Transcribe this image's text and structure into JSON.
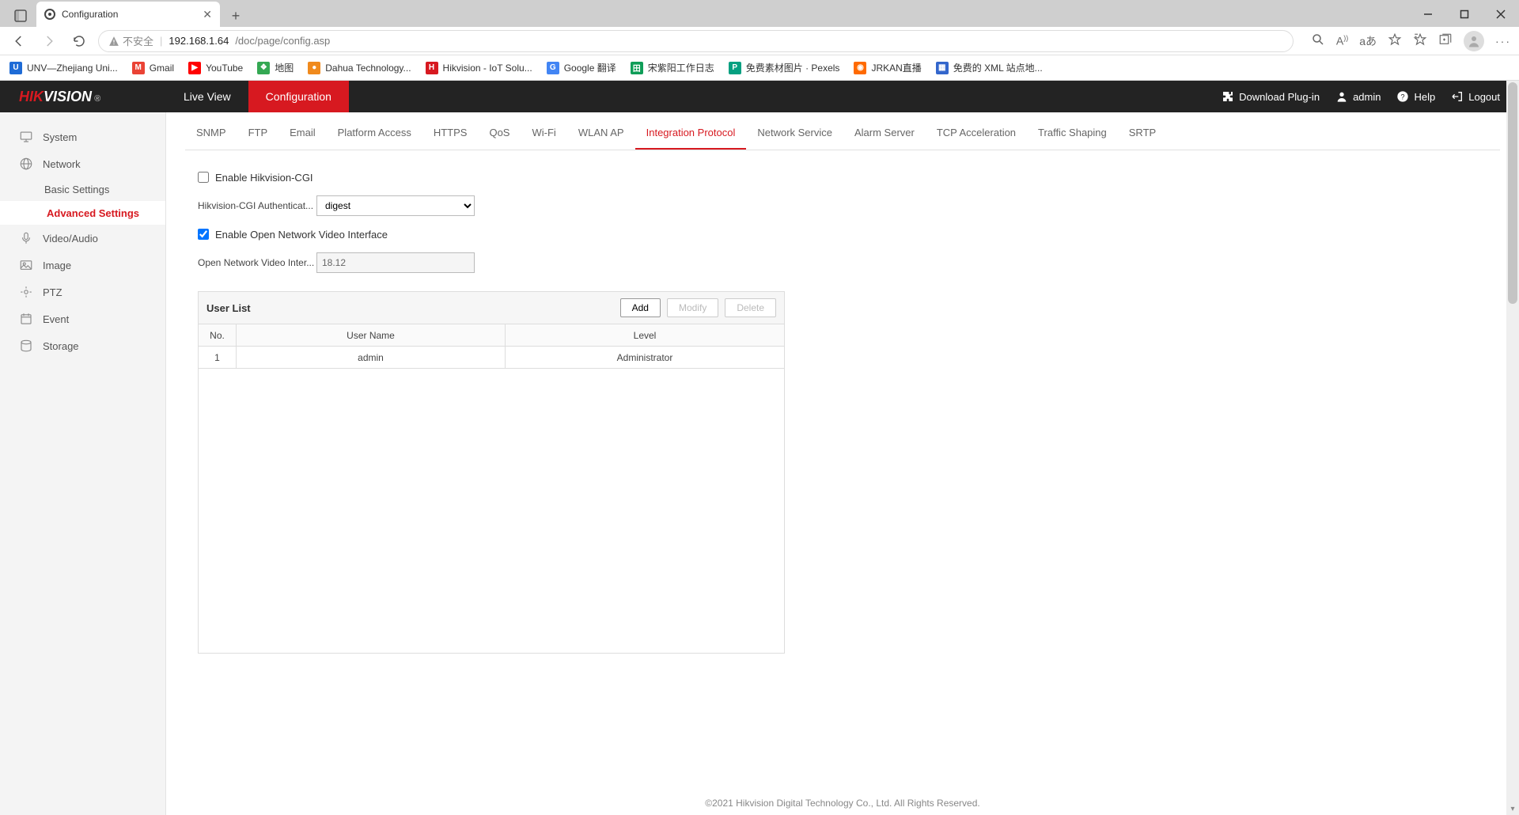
{
  "browser": {
    "tab_title": "Configuration",
    "url_warn": "不安全",
    "url_host": "192.168.1.64",
    "url_path": "/doc/page/config.asp",
    "bookmarks": [
      {
        "label": "UNV—Zhejiang Uni...",
        "color": "#1e6bd6",
        "txt": "U"
      },
      {
        "label": "Gmail",
        "color": "#ea4335",
        "txt": "M"
      },
      {
        "label": "YouTube",
        "color": "#ff0000",
        "txt": "▶"
      },
      {
        "label": "地图",
        "color": "#34a853",
        "txt": "❖"
      },
      {
        "label": "Dahua Technology...",
        "color": "#f08a1d",
        "txt": "●"
      },
      {
        "label": "Hikvision - IoT Solu...",
        "color": "#d71920",
        "txt": "H"
      },
      {
        "label": "Google 翻译",
        "color": "#4285f4",
        "txt": "G"
      },
      {
        "label": "宋紫阳工作日志",
        "color": "#0f9d58",
        "txt": "田"
      },
      {
        "label": "免费素材图片 · Pexels",
        "color": "#05a081",
        "txt": "P"
      },
      {
        "label": "JRKAN直播",
        "color": "#ff6a00",
        "txt": "◉"
      },
      {
        "label": "免费的 XML 站点地...",
        "color": "#3366cc",
        "txt": "▦"
      }
    ]
  },
  "topnav": {
    "live_view": "Live View",
    "configuration": "Configuration",
    "download": "Download Plug-in",
    "user": "admin",
    "help": "Help",
    "logout": "Logout"
  },
  "sidebar": {
    "system": "System",
    "network": "Network",
    "network_basic": "Basic Settings",
    "network_advanced": "Advanced Settings",
    "video_audio": "Video/Audio",
    "image": "Image",
    "ptz": "PTZ",
    "event": "Event",
    "storage": "Storage"
  },
  "subtabs": [
    "SNMP",
    "FTP",
    "Email",
    "Platform Access",
    "HTTPS",
    "QoS",
    "Wi-Fi",
    "WLAN AP",
    "Integration Protocol",
    "Network Service",
    "Alarm Server",
    "TCP Acceleration",
    "Traffic Shaping",
    "SRTP"
  ],
  "subtab_active": "Integration Protocol",
  "form": {
    "enable_cgi_label": "Enable Hikvision-CGI",
    "enable_cgi_checked": false,
    "cgi_auth_label": "Hikvision-CGI Authenticat...",
    "cgi_auth_value": "digest",
    "enable_onvif_label": "Enable Open Network Video Interface",
    "enable_onvif_checked": true,
    "onvif_ver_label": "Open Network Video Inter...",
    "onvif_ver_value": "18.12"
  },
  "userlist": {
    "title": "User List",
    "add": "Add",
    "modify": "Modify",
    "delete": "Delete",
    "cols": {
      "no": "No.",
      "user": "User Name",
      "level": "Level"
    },
    "rows": [
      {
        "no": "1",
        "user": "admin",
        "level": "Administrator"
      }
    ]
  },
  "footer": "©2021 Hikvision Digital Technology Co., Ltd. All Rights Reserved."
}
